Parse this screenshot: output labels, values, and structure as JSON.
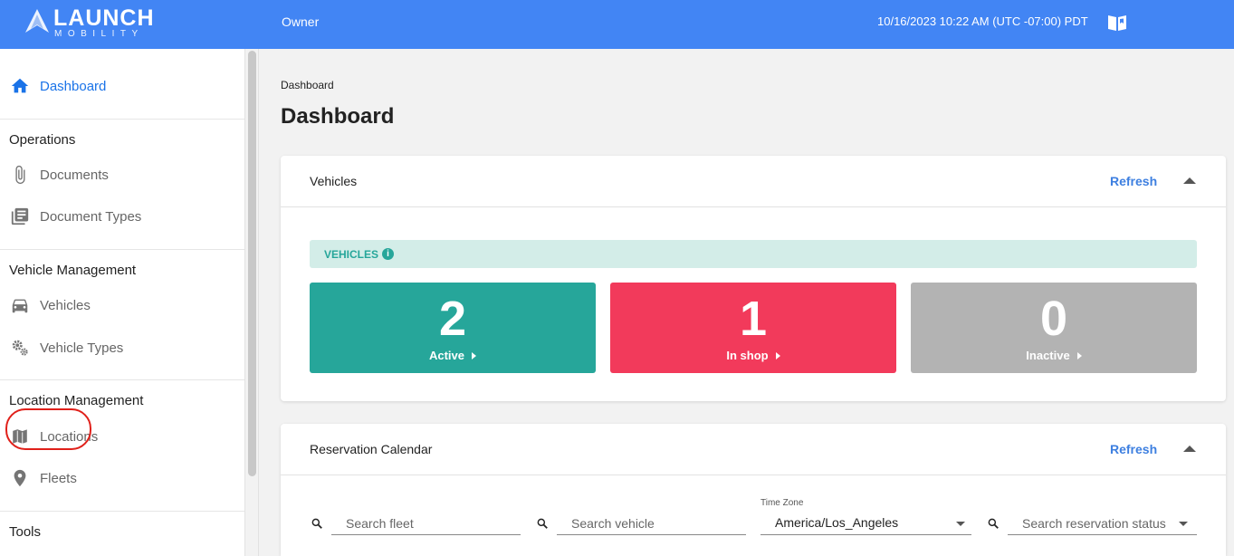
{
  "header": {
    "logo_main": "LAUNCH",
    "logo_sub": "MOBILITY",
    "role": "Owner",
    "datetime": "10/16/2023 10:22 AM (UTC -07:00) PDT",
    "help_icon": "book-open-icon"
  },
  "sidebar": {
    "dashboard": {
      "label": "Dashboard",
      "icon": "home-icon"
    },
    "sections": [
      {
        "title": "Operations",
        "items": [
          {
            "label": "Documents",
            "icon": "paperclip-icon"
          },
          {
            "label": "Document Types",
            "icon": "library-books-icon"
          }
        ]
      },
      {
        "title": "Vehicle Management",
        "items": [
          {
            "label": "Vehicles",
            "icon": "car-icon"
          },
          {
            "label": "Vehicle Types",
            "icon": "gears-icon"
          }
        ]
      },
      {
        "title": "Location Management",
        "items": [
          {
            "label": "Locations",
            "icon": "map-icon"
          },
          {
            "label": "Fleets",
            "icon": "location-pin-icon"
          }
        ]
      },
      {
        "title": "Tools",
        "items": []
      }
    ]
  },
  "main": {
    "breadcrumb": "Dashboard",
    "title": "Dashboard",
    "vehicles_card": {
      "title": "Vehicles",
      "refresh": "Refresh",
      "banner": "VEHICLES",
      "stats": [
        {
          "value": "2",
          "label": "Active",
          "color": "#26a69a"
        },
        {
          "value": "1",
          "label": "In shop",
          "color": "#f23a5b"
        },
        {
          "value": "0",
          "label": "Inactive",
          "color": "#b3b3b3"
        }
      ]
    },
    "calendar_card": {
      "title": "Reservation Calendar",
      "refresh": "Refresh",
      "search_fleet_placeholder": "Search fleet",
      "search_vehicle_placeholder": "Search vehicle",
      "timezone_label": "Time Zone",
      "timezone_value": "America/Los_Angeles",
      "reservation_status_placeholder": "Search reservation status"
    }
  },
  "colors": {
    "header": "#4285f4",
    "accent": "#1a73e8",
    "highlight_circle": "#e0201a"
  }
}
